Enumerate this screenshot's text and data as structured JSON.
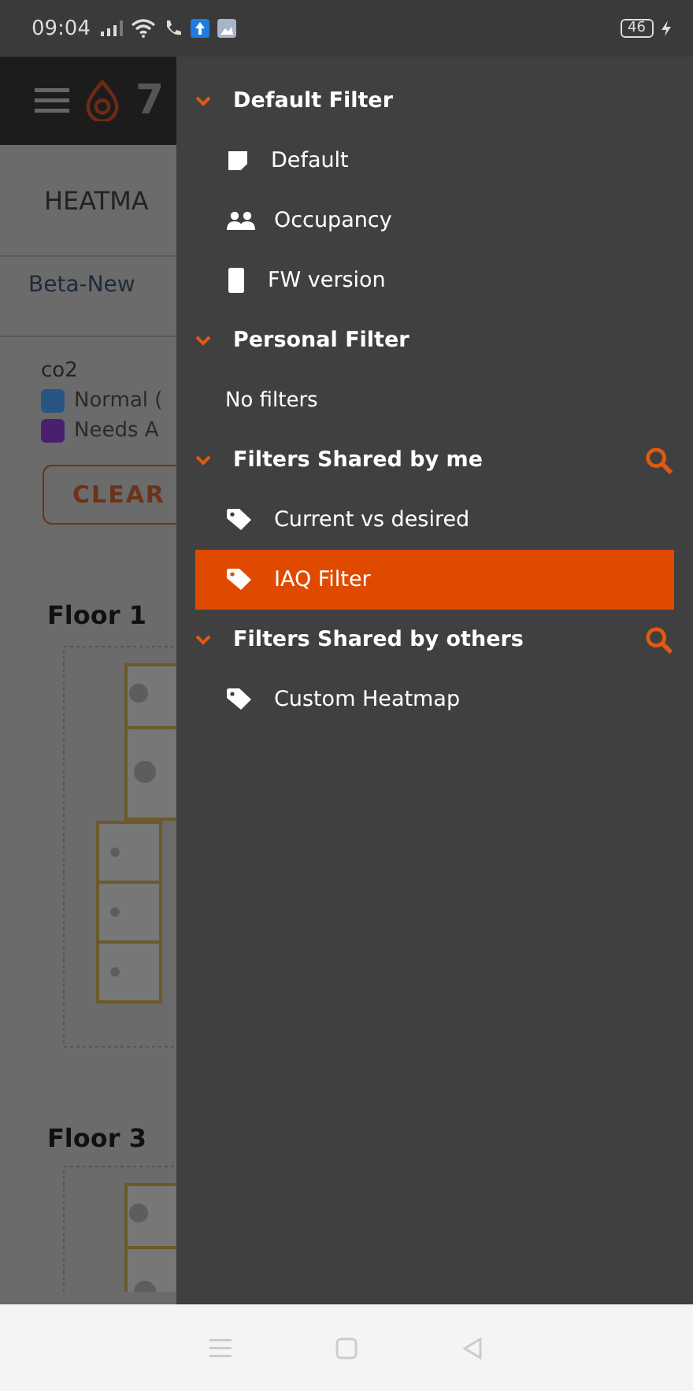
{
  "status_bar": {
    "time": "09:04",
    "battery": "46"
  },
  "app": {
    "logo": "7",
    "title": "HEATMA",
    "tab": "Beta-New",
    "legend_title": "co2",
    "legend": [
      {
        "label": "Normal (",
        "color": "#285582"
      },
      {
        "label": "Needs A",
        "color": "#4a1f6e"
      }
    ],
    "clear_button": "CLEAR",
    "floors": [
      "Floor 1",
      "Floor 3"
    ]
  },
  "drawer": {
    "sections": [
      {
        "title": "Default Filter",
        "expanded": true,
        "searchable": false,
        "items": [
          {
            "label": "Default",
            "kind": "note",
            "selected": false
          },
          {
            "label": "Occupancy",
            "kind": "people",
            "selected": false
          },
          {
            "label": "FW version",
            "kind": "device",
            "selected": false
          }
        ]
      },
      {
        "title": "Personal Filter",
        "expanded": true,
        "searchable": false,
        "empty_text": "No filters"
      },
      {
        "title": "Filters Shared by me",
        "expanded": true,
        "searchable": true,
        "items": [
          {
            "label": "Current vs desired",
            "kind": "tag",
            "selected": false
          },
          {
            "label": "IAQ Filter",
            "kind": "tag",
            "selected": true
          }
        ]
      },
      {
        "title": "Filters Shared by others",
        "expanded": true,
        "searchable": true,
        "items": [
          {
            "label": "Custom Heatmap",
            "kind": "tag",
            "selected": false
          }
        ]
      }
    ]
  }
}
